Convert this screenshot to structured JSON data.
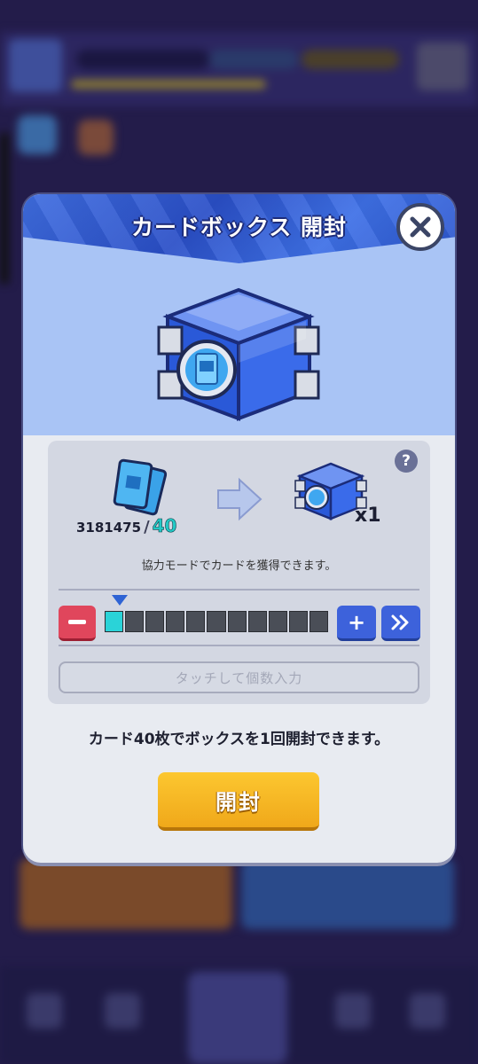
{
  "modal": {
    "title": "カードボックス 開封",
    "close_icon": "close-x-icon"
  },
  "exchange": {
    "owned_cards": "3181475",
    "separator": "/",
    "required_cards": "40",
    "result_quantity": "x1",
    "info": "協力モードでカードを獲得できます。",
    "help_label": "?"
  },
  "quantity": {
    "slider_fraction": 0.08,
    "segments": 11,
    "filled_segments": 1,
    "plus_label": "+",
    "touch_input_placeholder": "タッチして個数入力"
  },
  "description": "カード40枚でボックスを1回開封できます。",
  "open_button_label": "開封",
  "colors": {
    "header_band": "#2a4fc7",
    "header_bg": "#a9c4f5",
    "accent_cyan": "#22c9c5",
    "minus_red": "#e0465c",
    "plus_blue": "#3d62db",
    "open_orange": "#f0a81a"
  }
}
